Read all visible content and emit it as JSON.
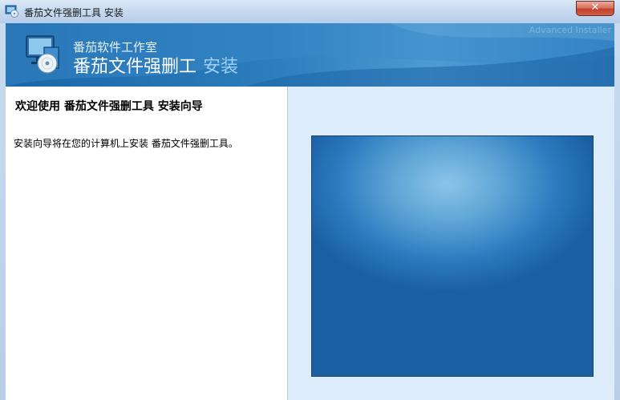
{
  "window": {
    "title": "番茄文件强删工具 安装",
    "close_label": "✕"
  },
  "banner": {
    "company": "番茄软件工作室",
    "product": "番茄文件强删工",
    "suffix": "安装",
    "watermark": "Advanced Installer"
  },
  "welcome": {
    "heading": "欢迎使用 番茄文件强删工具 安装向导",
    "body": "安装向导将在您的计算机上安装 番茄文件强删工具。"
  },
  "colors": {
    "banner_blue": "#2c7ebd",
    "side_panel": "#dcecfa",
    "close_red": "#c2402a"
  }
}
